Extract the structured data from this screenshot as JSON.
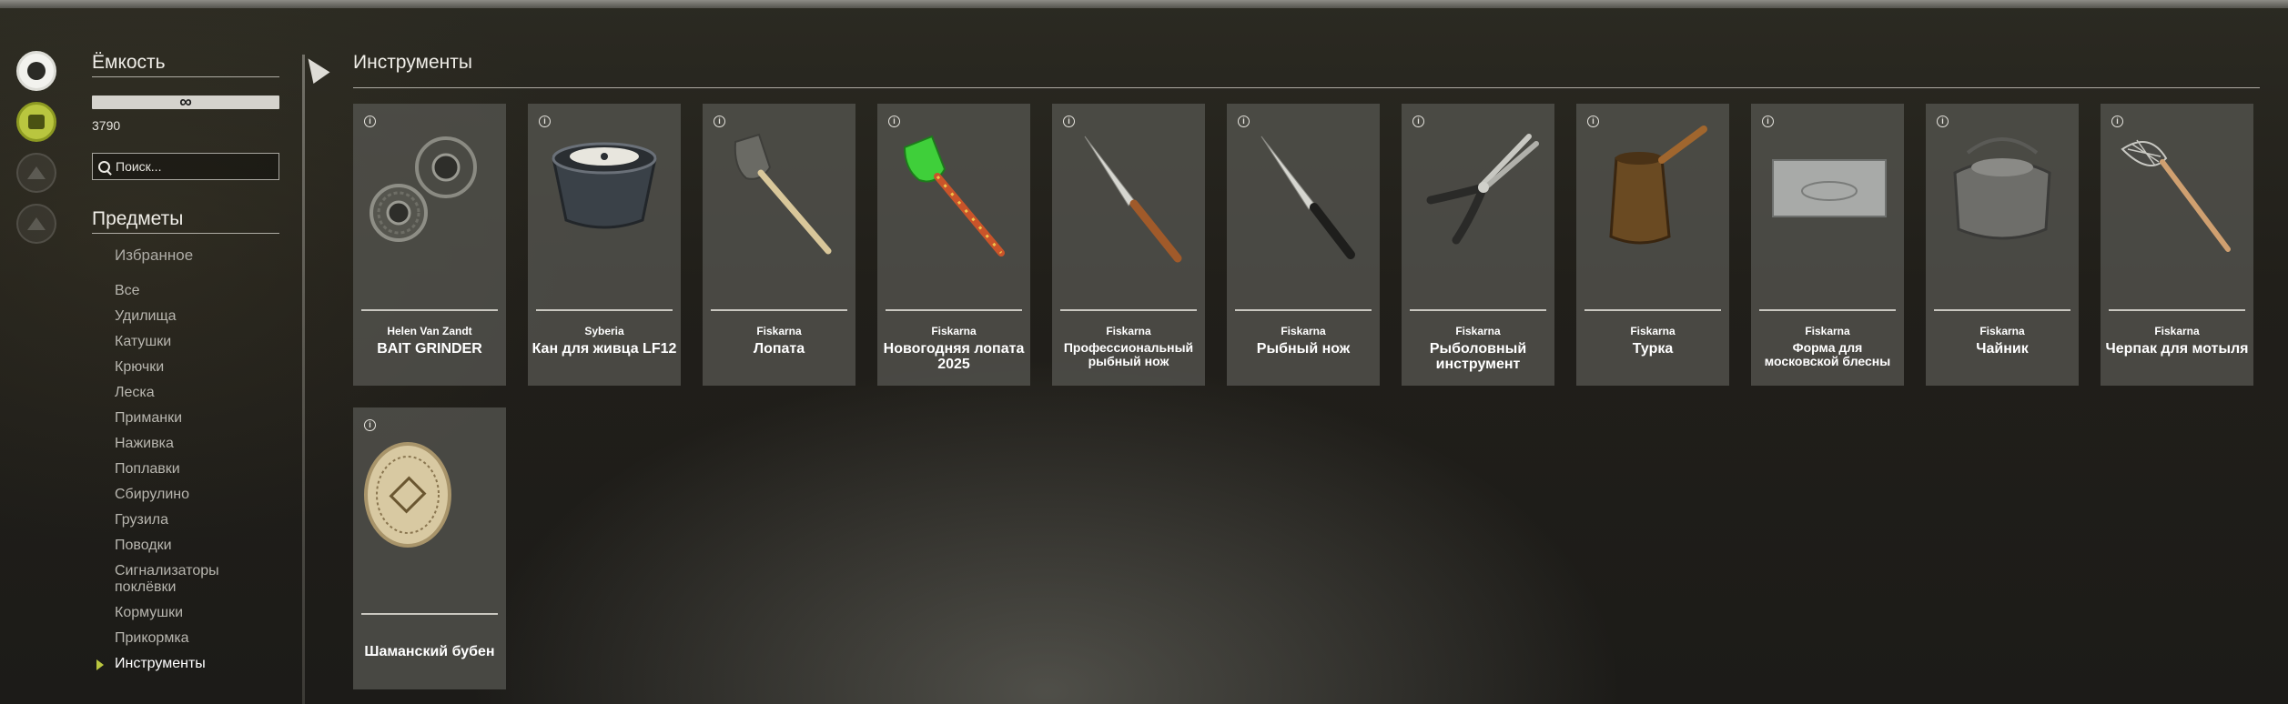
{
  "rail": {
    "icons": [
      "fish-icon",
      "tackle-icon",
      "boat-icon",
      "home-icon"
    ]
  },
  "capacity": {
    "title": "Ёмкость",
    "bar_value": "∞",
    "count": "3790"
  },
  "search": {
    "placeholder": "Поиск..."
  },
  "items_section": {
    "title": "Предметы",
    "favorites": "Избранное",
    "categories": [
      "Все",
      "Удилища",
      "Катушки",
      "Крючки",
      "Леска",
      "Приманки",
      "Наживка",
      "Поплавки",
      "Сбирулино",
      "Грузила",
      "Поводки",
      "Сигнализаторы поклёвки",
      "Кормушки",
      "Прикормка",
      "Инструменты"
    ],
    "active_category": "Инструменты"
  },
  "main": {
    "title": "Инструменты",
    "cards": [
      {
        "brand": "Helen Van Zandt",
        "name": "BAIT GRINDER",
        "icon": "bait-grinder-icon"
      },
      {
        "brand": "Syberia",
        "name": "Кан для живца LF12",
        "icon": "bait-bucket-icon"
      },
      {
        "brand": "Fiskarna",
        "name": "Лопата",
        "icon": "shovel-icon"
      },
      {
        "brand": "Fiskarna",
        "name": "Новогодняя лопата 2025",
        "icon": "green-shovel-icon"
      },
      {
        "brand": "Fiskarna",
        "name": "Профессиональный рыбный нож",
        "icon": "pro-fish-knife-icon"
      },
      {
        "brand": "Fiskarna",
        "name": "Рыбный нож",
        "icon": "fish-knife-icon"
      },
      {
        "brand": "Fiskarna",
        "name": "Рыболовный инструмент",
        "icon": "pliers-icon"
      },
      {
        "brand": "Fiskarna",
        "name": "Турка",
        "icon": "turka-icon"
      },
      {
        "brand": "Fiskarna",
        "name": "Форма для московской блесны",
        "icon": "lure-mold-icon"
      },
      {
        "brand": "Fiskarna",
        "name": "Чайник",
        "icon": "kettle-icon"
      },
      {
        "brand": "Fiskarna",
        "name": "Черпак для мотыля",
        "icon": "scoop-icon"
      },
      {
        "brand": "",
        "name": "Шаманский бубен",
        "icon": "shaman-drum-icon"
      }
    ],
    "colors": {
      "accent": "#b9c63f",
      "card_bg": "#555450"
    }
  }
}
